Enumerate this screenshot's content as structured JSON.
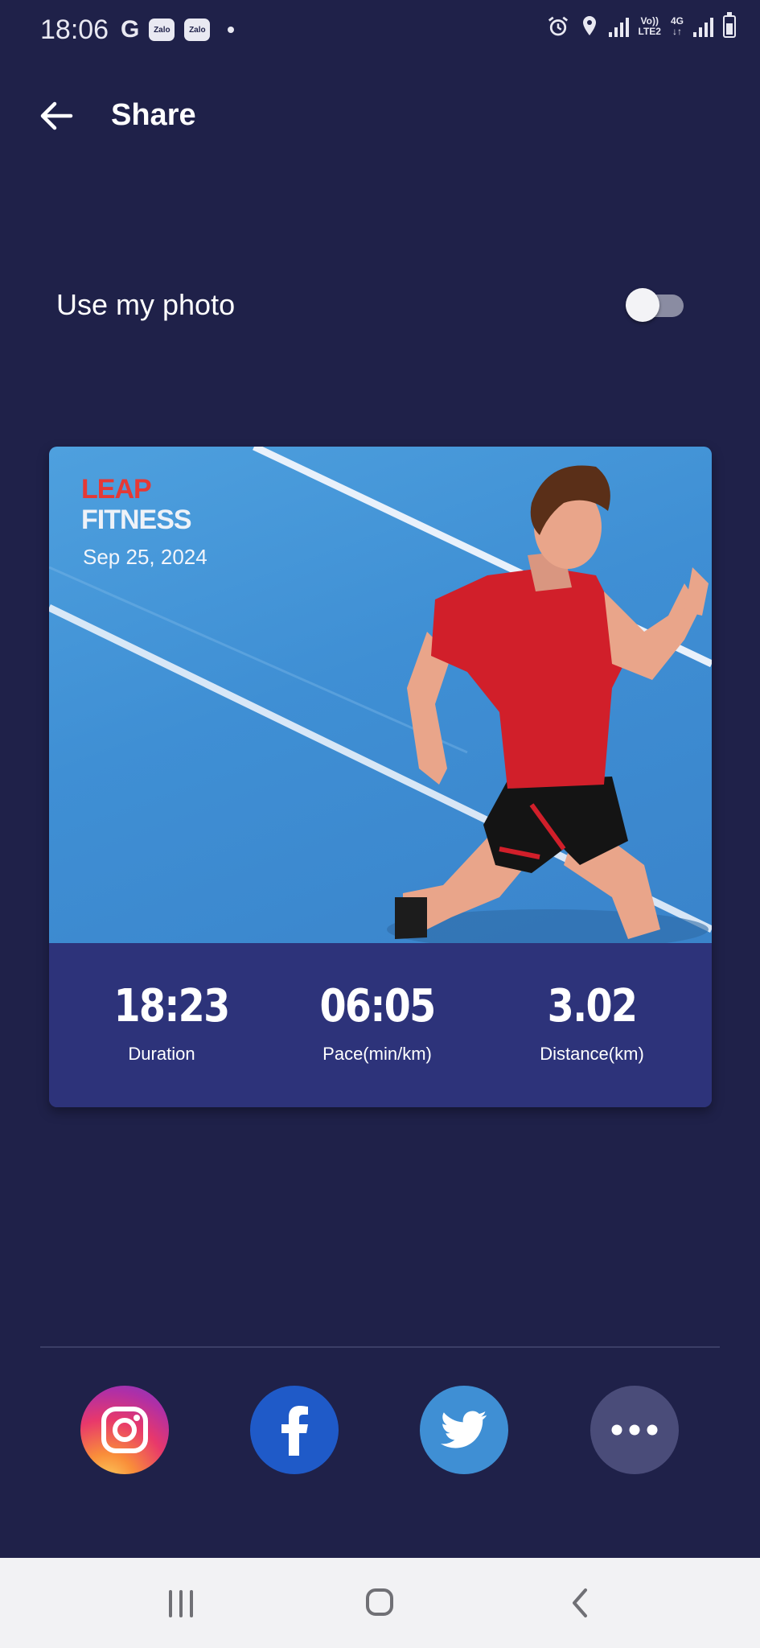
{
  "status_bar": {
    "time": "18:06",
    "g_icon": "G",
    "zalo_label": "Zalo",
    "network_volte": "Vo))",
    "network_lte": "LTE2",
    "network_4g": "4G"
  },
  "header": {
    "title": "Share",
    "back_icon": "arrow-left-icon"
  },
  "settings": {
    "use_my_photo_label": "Use my photo",
    "use_my_photo_enabled": false
  },
  "card": {
    "brand_line1": "LEAP",
    "brand_line2": "FITNESS",
    "date": "Sep 25, 2024",
    "stats": [
      {
        "value": "18:23",
        "label": "Duration"
      },
      {
        "value": "06:05",
        "label": "Pace(min/km)"
      },
      {
        "value": "3.02",
        "label": "Distance(km)"
      }
    ]
  },
  "share_buttons": [
    {
      "name": "instagram",
      "icon": "instagram-icon"
    },
    {
      "name": "facebook",
      "icon": "facebook-icon"
    },
    {
      "name": "twitter",
      "icon": "twitter-icon"
    },
    {
      "name": "more",
      "icon": "more-dots-icon"
    }
  ],
  "colors": {
    "background": "#1f2149",
    "card_stats_bg": "#2d337a",
    "brand_red": "#e53935",
    "facebook": "#1f5ac8",
    "twitter": "#3f8fd4",
    "more": "#4a4c79"
  }
}
